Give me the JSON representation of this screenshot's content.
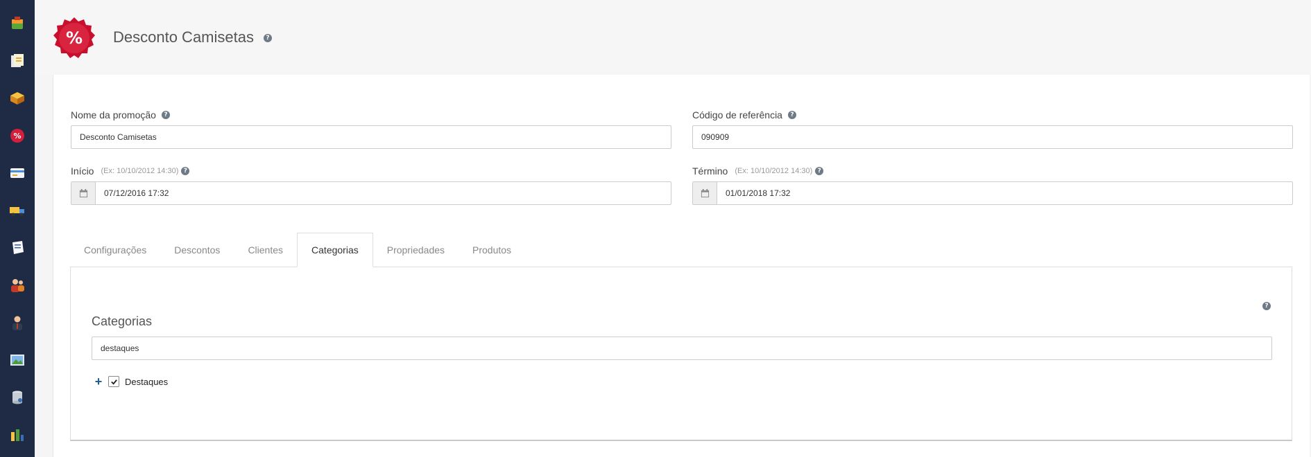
{
  "header": {
    "title": "Desconto Camisetas",
    "badge_symbol": "%",
    "badge_color": "#d21f3c"
  },
  "form": {
    "nome": {
      "label": "Nome da promoção",
      "value": "Desconto Camisetas"
    },
    "codigo": {
      "label": "Código de referência",
      "value": "090909"
    },
    "inicio": {
      "label": "Início",
      "hint": "(Ex: 10/10/2012 14:30)",
      "value": "07/12/2016 17:32"
    },
    "termino": {
      "label": "Término",
      "hint": "(Ex: 10/10/2012 14:30)",
      "value": "01/01/2018 17:32"
    }
  },
  "tabs": [
    {
      "label": "Configurações"
    },
    {
      "label": "Descontos"
    },
    {
      "label": "Clientes"
    },
    {
      "label": "Categorias",
      "active": true
    },
    {
      "label": "Propriedades"
    },
    {
      "label": "Produtos"
    }
  ],
  "categorias": {
    "title": "Categorias",
    "filter_value": "destaques",
    "tree": [
      {
        "label": "Destaques",
        "checked": true,
        "expand_symbol": "+"
      }
    ]
  },
  "sidebar": {
    "items": [
      {
        "icon": "package-icon"
      },
      {
        "icon": "document-icon"
      },
      {
        "icon": "boxes-icon"
      },
      {
        "icon": "promotion-icon"
      },
      {
        "icon": "credit-card-icon"
      },
      {
        "icon": "truck-icon"
      },
      {
        "icon": "note-icon"
      },
      {
        "icon": "users-icon"
      },
      {
        "icon": "user-icon"
      },
      {
        "icon": "image-icon"
      },
      {
        "icon": "database-icon"
      },
      {
        "icon": "report-icon"
      }
    ]
  },
  "colors": {
    "sidebar_bg": "#1f2a44",
    "accent_blue": "#1d5f9c",
    "badge_red": "#d21f3c"
  }
}
